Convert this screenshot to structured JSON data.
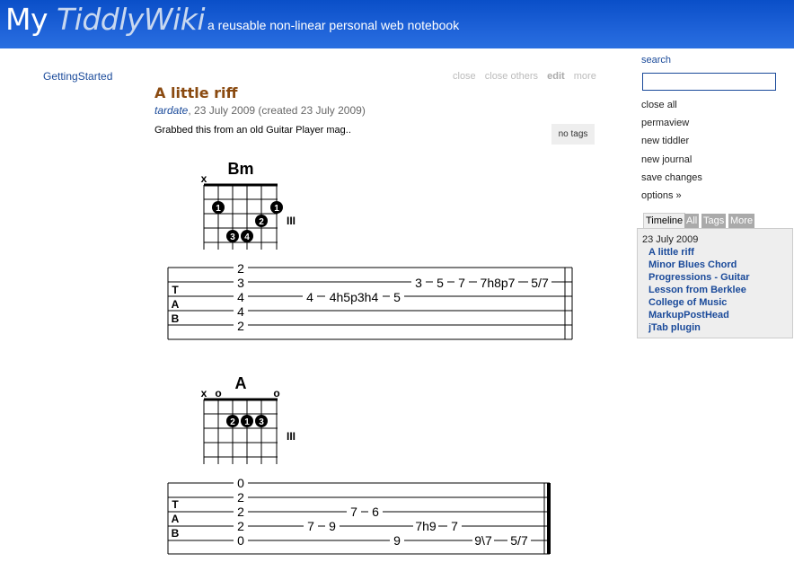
{
  "header": {
    "title_my": "My",
    "title_wiki": "TiddlyWiki",
    "subtitle": "a reusable non-linear personal web notebook"
  },
  "mainmenu": {
    "item": "GettingStarted"
  },
  "tiddler": {
    "toolbar": {
      "close": "close",
      "close_others": "close others",
      "edit": "edit",
      "more": "more"
    },
    "title": "A little riff",
    "author": "tardate",
    "date_text": ", 23 July 2009 (created 23 July 2009)",
    "body": "Grabbed this from an old Guitar Player mag..",
    "tags": "no tags"
  },
  "sidebar": {
    "search_label": "search",
    "search_value": "",
    "links": [
      "close all",
      "permaview",
      "new tiddler",
      "new journal",
      "save changes",
      "options »"
    ],
    "tabs": [
      "Timeline",
      "All",
      "Tags",
      "More"
    ],
    "timeline_date": "23 July 2009",
    "timeline_items": [
      "A little riff",
      "Minor Blues Chord",
      "Progressions - Guitar",
      "Lesson from Berklee",
      "College of Music",
      "MarkupPostHead",
      "jTab plugin"
    ]
  },
  "music": {
    "chord1": {
      "name": "Bm",
      "x_marks": [
        "x"
      ],
      "fingers": [
        "1",
        "1",
        "2",
        "3",
        "4"
      ],
      "fret_label": "III"
    },
    "chord2": {
      "name": "A",
      "x_marks": [
        "x"
      ],
      "o_marks": [
        "o",
        "o"
      ],
      "fingers": [
        "2",
        "1",
        "3"
      ],
      "fret_label": "III"
    },
    "tab_letters": [
      "T",
      "A",
      "B"
    ],
    "tab1": [
      {
        "t": "2",
        "s": 1
      },
      {
        "t": "3",
        "s": 2
      },
      {
        "t": "4",
        "s": 3
      },
      {
        "t": "4",
        "s": 4
      },
      {
        "t": "2",
        "s": 5
      },
      {
        "t": "4",
        "s": 3
      },
      {
        "t": "4h5p3h4",
        "s": 3
      },
      {
        "t": "5",
        "s": 3
      },
      {
        "t": "3",
        "s": 2
      },
      {
        "t": "5",
        "s": 2
      },
      {
        "t": "7",
        "s": 2
      },
      {
        "t": "7h8p7",
        "s": 2
      },
      {
        "t": "5/7",
        "s": 2
      }
    ],
    "tab2": [
      {
        "t": "0",
        "s": 0
      },
      {
        "t": "2",
        "s": 1
      },
      {
        "t": "2",
        "s": 2
      },
      {
        "t": "2",
        "s": 3
      },
      {
        "t": "0",
        "s": 4
      },
      {
        "t": "7",
        "s": 3
      },
      {
        "t": "9",
        "s": 3
      },
      {
        "t": "7",
        "s": 2
      },
      {
        "t": "6",
        "s": 2
      },
      {
        "t": "9",
        "s": 5
      },
      {
        "t": "7h9",
        "s": 3
      },
      {
        "t": "7",
        "s": 3
      },
      {
        "t": "9\\7",
        "s": 5
      },
      {
        "t": "5/7",
        "s": 5
      }
    ]
  }
}
